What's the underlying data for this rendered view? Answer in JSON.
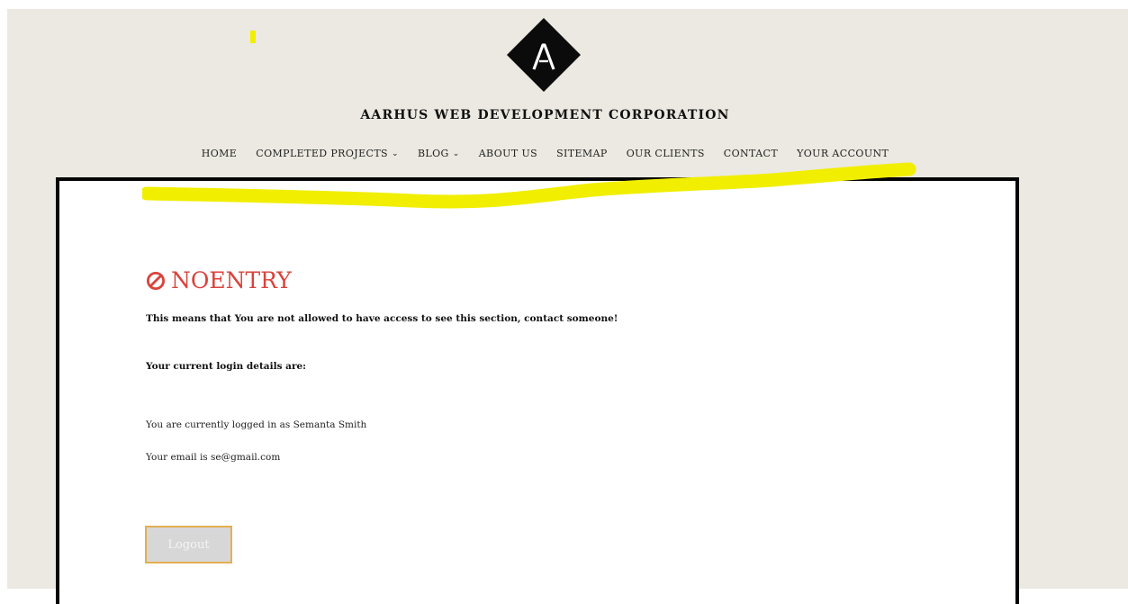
{
  "site": {
    "title": "AARHUS WEB DEVELOPMENT CORPORATION"
  },
  "nav": {
    "items": [
      {
        "label": "HOME",
        "has_dropdown": false
      },
      {
        "label": "COMPLETED PROJECTS",
        "has_dropdown": true
      },
      {
        "label": "BLOG",
        "has_dropdown": true
      },
      {
        "label": "ABOUT US",
        "has_dropdown": false
      },
      {
        "label": "SITEMAP",
        "has_dropdown": false
      },
      {
        "label": "OUR CLIENTS",
        "has_dropdown": false
      },
      {
        "label": "CONTACT",
        "has_dropdown": false
      },
      {
        "label": "YOUR ACCOUNT",
        "has_dropdown": false
      }
    ],
    "dropdown_glyph": "⌄"
  },
  "content": {
    "heading": "NOENTRY",
    "message": "This means that You are not allowed to have access to see this section, contact someone!",
    "login_details_label": "Your current login details are:",
    "logged_in_text": "You are currently logged in as Semanta Smith",
    "email_text": "Your email is se@gmail.com",
    "logout_label": "Logout"
  },
  "colors": {
    "page_background": "#ebe9e1",
    "heading_red": "#d9433b",
    "highlight_yellow": "#f1ee00",
    "button_border": "#e3b052"
  },
  "icons": {
    "logo": "diamond-a-logo-icon",
    "heading": "no-entry-icon"
  }
}
